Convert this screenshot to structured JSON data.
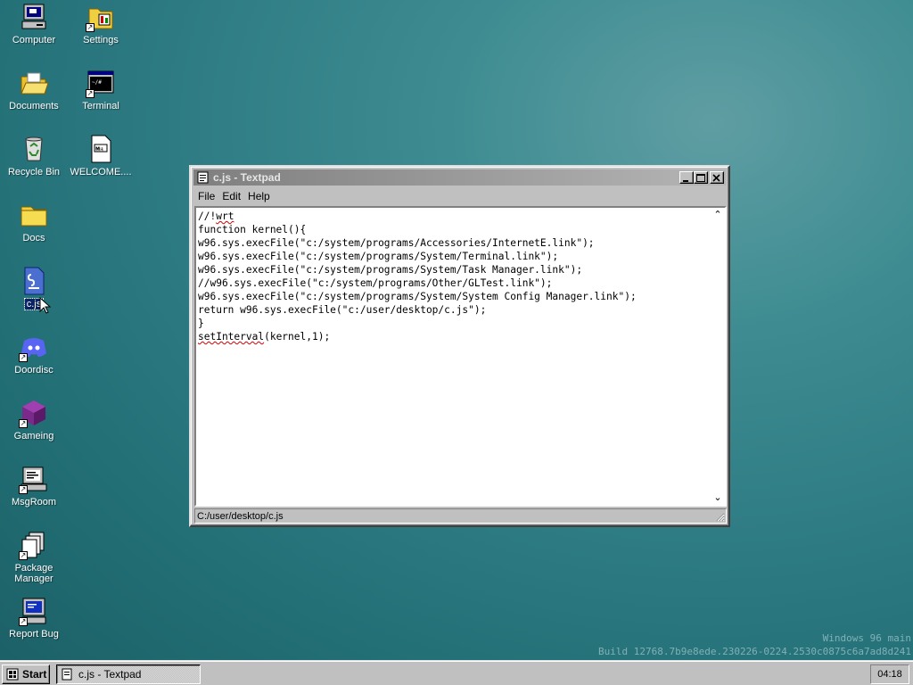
{
  "desktop": {
    "icons": [
      {
        "label": "Computer",
        "icon": "computer-icon"
      },
      {
        "label": "Settings",
        "icon": "settings-icon"
      },
      {
        "label": "Documents",
        "icon": "open-folder-icon"
      },
      {
        "label": "Terminal",
        "icon": "terminal-icon"
      },
      {
        "label": "Recycle Bin",
        "icon": "recycle-bin-icon"
      },
      {
        "label": "WELCOME....",
        "icon": "markdown-file-icon"
      },
      {
        "label": "Docs",
        "icon": "folder-icon"
      },
      {
        "label": "c.js",
        "icon": "js-file-icon"
      },
      {
        "label": "Doordisc",
        "icon": "discord-icon"
      },
      {
        "label": "Gameing",
        "icon": "purple-cube-icon"
      },
      {
        "label": "MsgRoom",
        "icon": "msgroom-icon"
      },
      {
        "label": "Package Manager",
        "icon": "package-manager-icon"
      },
      {
        "label": "Report Bug",
        "icon": "report-bug-icon"
      }
    ],
    "watermark": {
      "line1": "Windows 96 main",
      "line2": "Build 12768.7b9e8ede.230226-0224.2530c0875c6a7ad8d241"
    }
  },
  "window": {
    "title": "c.js - Textpad",
    "menu": [
      "File",
      "Edit",
      "Help"
    ],
    "code_lines": [
      "//!wrt",
      "function kernel(){",
      "w96.sys.execFile(\"c:/system/programs/Accessories/InternetE.link\");",
      "w96.sys.execFile(\"c:/system/programs/System/Terminal.link\");",
      "w96.sys.execFile(\"c:/system/programs/System/Task Manager.link\");",
      "//w96.sys.execFile(\"c:/system/programs/Other/GLTest.link\");",
      "w96.sys.execFile(\"c:/system/programs/System/System Config Manager.link\");",
      "return w96.sys.execFile(\"c:/user/desktop/c.js\");",
      "}",
      "setInterval(kernel,1);"
    ],
    "status_path": "C:/user/desktop/c.js"
  },
  "taskbar": {
    "start_label": "Start",
    "task_label": "c.js - Textpad",
    "clock": "04:18"
  },
  "colors": {
    "desktop": "#2d7a83",
    "window_face": "#c0c0c0",
    "titlebar_inactive": "#808080",
    "selection": "#0a246a"
  }
}
